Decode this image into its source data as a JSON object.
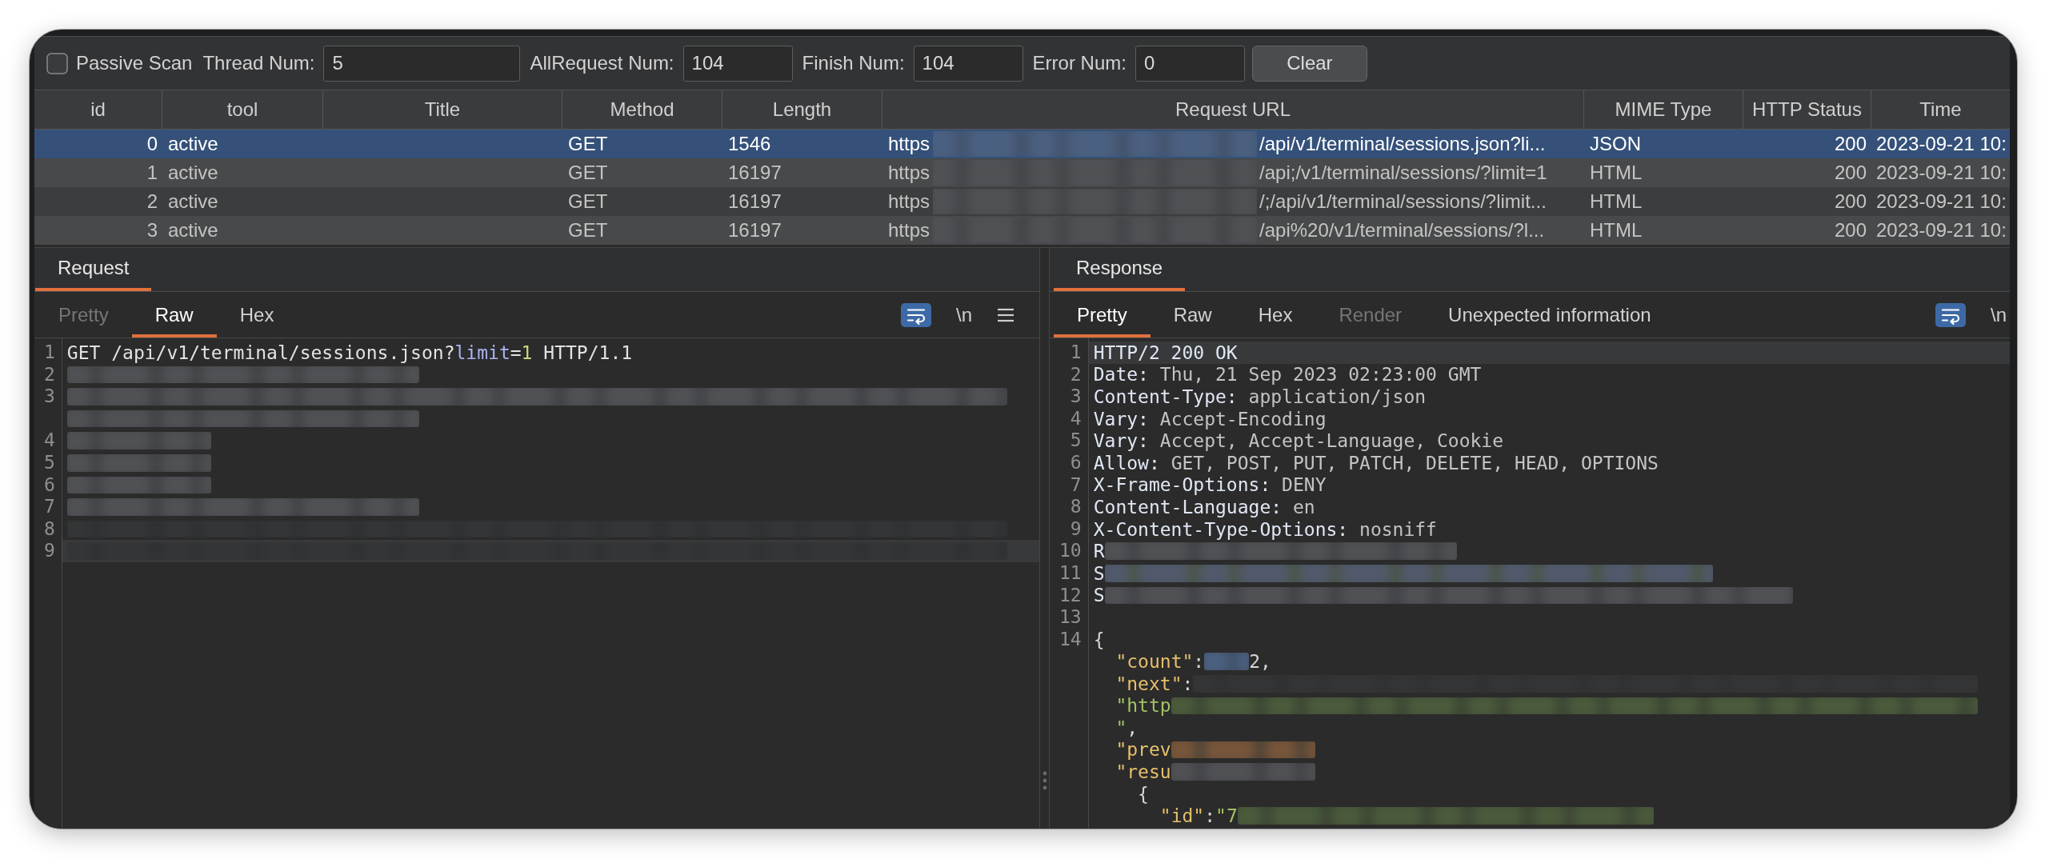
{
  "toolbar": {
    "passive_scan": {
      "label": "Passive Scan",
      "checked": false
    },
    "fields": [
      {
        "label": "Thread Num:",
        "value": "5"
      },
      {
        "label": "AllRequest Num:",
        "value": "104"
      },
      {
        "label": "Finish Num:",
        "value": "104"
      },
      {
        "label": "Error Num:",
        "value": "0"
      }
    ],
    "clear_button": "Clear"
  },
  "table": {
    "columns": [
      "id",
      "tool",
      "Title",
      "Method",
      "Length",
      "Request URL",
      "MIME Type",
      "HTTP Status",
      "Time"
    ],
    "rows": [
      {
        "id": "0",
        "tool": "active",
        "method": "GET",
        "length": "1546",
        "url_start": "https",
        "url_end": "/api/v1/terminal/sessions.json?li...",
        "mime_type": "JSON",
        "http_status": "200",
        "time": "2023-09-21 10:",
        "selected": true
      },
      {
        "id": "1",
        "tool": "active",
        "method": "GET",
        "length": "16197",
        "url_start": "https",
        "url_end": "/api;/v1/terminal/sessions/?limit=1",
        "mime_type": "HTML",
        "http_status": "200",
        "time": "2023-09-21 10:",
        "selected": false
      },
      {
        "id": "2",
        "tool": "active",
        "method": "GET",
        "length": "16197",
        "url_start": "https",
        "url_end": "/;/api/v1/terminal/sessions/?limit...",
        "mime_type": "HTML",
        "http_status": "200",
        "time": "2023-09-21 10:",
        "selected": false
      },
      {
        "id": "3",
        "tool": "active",
        "method": "GET",
        "length": "16197",
        "url_start": "https",
        "url_end": "/api%20/v1/terminal/sessions/?l...",
        "mime_type": "HTML",
        "http_status": "200",
        "time": "2023-09-21 10:",
        "selected": false
      }
    ]
  },
  "request": {
    "tabs": [
      {
        "label": "Request",
        "selected": true
      }
    ],
    "views": [
      {
        "label": "Pretty",
        "selected": false,
        "disabled": true
      },
      {
        "label": "Raw",
        "selected": true,
        "disabled": false
      },
      {
        "label": "Hex",
        "selected": false,
        "disabled": false
      }
    ],
    "tools": [
      {
        "kind": "wrap",
        "on": true
      },
      {
        "kind": "newline",
        "label": "\\n",
        "on": false
      },
      {
        "kind": "menu"
      }
    ],
    "lines": [
      {
        "number": "1",
        "current": false,
        "parts": [
          {
            "kind": "plain",
            "text": "GET /api/v1/terminal/sessions.json?"
          },
          {
            "kind": "param",
            "text": "limit"
          },
          {
            "kind": "plain",
            "text": "="
          },
          {
            "kind": "number",
            "text": "1"
          },
          {
            "kind": "plain",
            "text": " HTTP/1.1"
          }
        ]
      },
      {
        "number": "2",
        "current": false,
        "parts": [
          {
            "kind": "blur"
          }
        ]
      },
      {
        "number": "3",
        "current": false,
        "parts": [
          {
            "kind": "blur"
          }
        ]
      },
      {
        "current": false,
        "parts": [
          {
            "kind": "blur"
          }
        ]
      },
      {
        "number": "4",
        "current": false,
        "parts": [
          {
            "kind": "blur"
          }
        ]
      },
      {
        "number": "5",
        "current": false,
        "parts": [
          {
            "kind": "blur"
          }
        ]
      },
      {
        "number": "6",
        "current": false,
        "parts": [
          {
            "kind": "blur"
          }
        ]
      },
      {
        "number": "7",
        "current": false,
        "parts": [
          {
            "kind": "blur"
          }
        ]
      },
      {
        "number": "8",
        "current": false,
        "parts": [
          {
            "kind": "blurfaint"
          }
        ]
      },
      {
        "number": "9",
        "current": true,
        "parts": [
          {
            "kind": "blurfaint"
          }
        ]
      }
    ]
  },
  "response": {
    "tabs": [
      {
        "label": "Response",
        "selected": true
      }
    ],
    "views": [
      {
        "label": "Pretty",
        "selected": true,
        "disabled": false
      },
      {
        "label": "Raw",
        "selected": false,
        "disabled": false
      },
      {
        "label": "Hex",
        "selected": false,
        "disabled": false
      },
      {
        "label": "Render",
        "selected": false,
        "disabled": true
      },
      {
        "label": "Unexpected information",
        "selected": false,
        "disabled": false
      }
    ],
    "tools": [
      {
        "kind": "wrap",
        "on": true
      },
      {
        "kind": "newline",
        "label": "\\n",
        "on": false
      }
    ],
    "lines": [
      {
        "number": "1",
        "current": true,
        "parts": [
          {
            "kind": "header",
            "text": "HTTP/2 200 OK"
          }
        ]
      },
      {
        "number": "2",
        "current": false,
        "parts": [
          {
            "kind": "header",
            "text": "Date:"
          },
          {
            "kind": "value",
            "text": " Thu, 21 Sep 2023 02:23:00 GMT"
          }
        ]
      },
      {
        "number": "3",
        "current": false,
        "parts": [
          {
            "kind": "header",
            "text": "Content-Type:"
          },
          {
            "kind": "value",
            "text": " application/json"
          }
        ]
      },
      {
        "number": "4",
        "current": false,
        "parts": [
          {
            "kind": "header",
            "text": "Vary:"
          },
          {
            "kind": "value",
            "text": " Accept-Encoding"
          }
        ]
      },
      {
        "number": "5",
        "current": false,
        "parts": [
          {
            "kind": "header",
            "text": "Vary:"
          },
          {
            "kind": "value",
            "text": " Accept, Accept-Language, Cookie"
          }
        ]
      },
      {
        "number": "6",
        "current": false,
        "parts": [
          {
            "kind": "header",
            "text": "Allow:"
          },
          {
            "kind": "value",
            "text": " GET, POST, PUT, PATCH, DELETE, HEAD, OPTIONS"
          }
        ]
      },
      {
        "number": "7",
        "current": false,
        "parts": [
          {
            "kind": "header",
            "text": "X-Frame-Options:"
          },
          {
            "kind": "value",
            "text": " DENY"
          }
        ]
      },
      {
        "number": "8",
        "current": false,
        "parts": [
          {
            "kind": "header",
            "text": "Content-Language:"
          },
          {
            "kind": "value",
            "text": " en"
          }
        ]
      },
      {
        "number": "9",
        "current": false,
        "parts": [
          {
            "kind": "header",
            "text": "X-Content-Type-Options:"
          },
          {
            "kind": "value",
            "text": " nosniff"
          }
        ]
      },
      {
        "number": "10",
        "current": false,
        "parts": [
          {
            "kind": "header",
            "text": "R"
          },
          {
            "kind": "blur"
          }
        ]
      },
      {
        "number": "11",
        "current": false,
        "parts": [
          {
            "kind": "header",
            "text": "S"
          },
          {
            "kind": "blurmixed"
          }
        ]
      },
      {
        "number": "12",
        "current": false,
        "parts": [
          {
            "kind": "header",
            "text": "S"
          },
          {
            "kind": "blur"
          }
        ]
      },
      {
        "number": "13",
        "current": false
      },
      {
        "number": "14",
        "current": false,
        "parts": [
          {
            "kind": "punct",
            "text": "{"
          }
        ]
      },
      {
        "current": false,
        "parts": [
          {
            "kind": "key",
            "text": "  \"count\""
          },
          {
            "kind": "punct",
            "text": ":"
          },
          {
            "kind": "blurnumber"
          },
          {
            "kind": "punct",
            "text": "2,"
          }
        ]
      },
      {
        "current": false,
        "parts": [
          {
            "kind": "key",
            "text": "  \"next\""
          },
          {
            "kind": "punct",
            "text": ":"
          },
          {
            "kind": "blurfaint"
          }
        ]
      },
      {
        "current": false,
        "parts": [
          {
            "kind": "string",
            "text": "  \"http"
          },
          {
            "kind": "blurstring"
          }
        ]
      },
      {
        "current": false,
        "parts": [
          {
            "kind": "string",
            "text": "  \""
          },
          {
            "kind": "punct",
            "text": ","
          }
        ]
      },
      {
        "current": false,
        "parts": [
          {
            "kind": "key",
            "text": "  \"prev"
          },
          {
            "kind": "blurnull"
          }
        ]
      },
      {
        "current": false,
        "parts": [
          {
            "kind": "key",
            "text": "  \"resu"
          },
          {
            "kind": "blur"
          }
        ]
      },
      {
        "current": false,
        "parts": [
          {
            "kind": "punct",
            "text": "    {"
          }
        ]
      },
      {
        "current": false,
        "parts": [
          {
            "kind": "key",
            "text": "      \"id\""
          },
          {
            "kind": "punct",
            "text": ":"
          },
          {
            "kind": "string",
            "text": "\"7"
          },
          {
            "kind": "blurstring"
          }
        ]
      }
    ]
  }
}
